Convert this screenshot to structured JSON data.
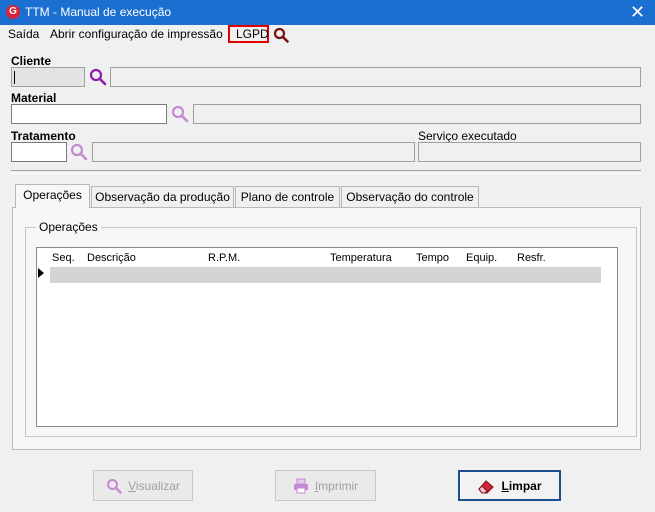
{
  "window": {
    "title": "TTM - Manual de execução",
    "logo_letter": "G",
    "close_glyph": "✕"
  },
  "menu": {
    "items": [
      "Saída",
      "Abrir configuração de impressão",
      "LGPD"
    ]
  },
  "form": {
    "cliente_label": "Cliente",
    "material_label": "Material",
    "tratamento_label": "Tratamento",
    "servico_label": "Serviço executado"
  },
  "tabs": [
    {
      "label": "Operações"
    },
    {
      "label": "Observação da produção"
    },
    {
      "label": "Plano de controle"
    },
    {
      "label": "Observação do controle"
    }
  ],
  "operations": {
    "group_label": "Operações",
    "columns": [
      "Seq.",
      "Descrição",
      "R.P.M.",
      "Temperatura",
      "Tempo",
      "Equip.",
      "Resfr."
    ]
  },
  "buttons": {
    "visualizar": "Visualizar",
    "imprimir": "Imprimir",
    "limpar": "Limpar"
  },
  "colors": {
    "titlebar": "#1b6fd1",
    "accent_lens": "#8b1fa8",
    "highlight_box": "#e00000"
  }
}
